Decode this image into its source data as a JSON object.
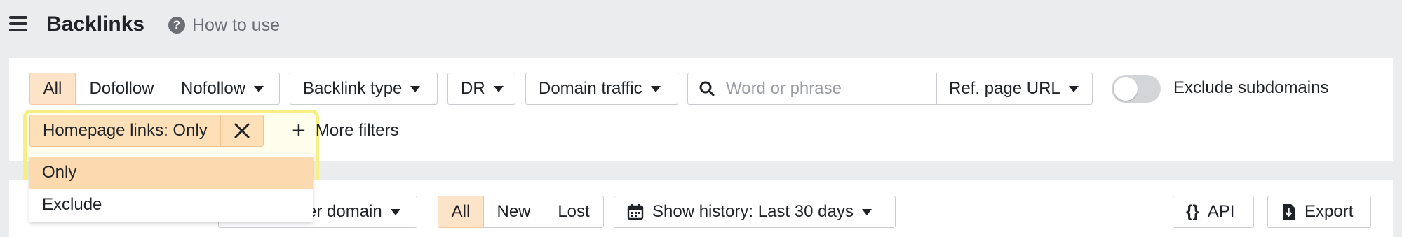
{
  "header": {
    "title": "Backlinks",
    "help_label": "How to use",
    "help_icon": "question-circle-icon",
    "menu_icon": "hamburger-menu-icon"
  },
  "filters": {
    "link_type_segments": [
      "All",
      "Dofollow",
      "Nofollow"
    ],
    "active_link_type": "All",
    "backlink_type": "Backlink type",
    "dr": "DR",
    "domain_traffic": "Domain traffic",
    "search": {
      "placeholder": "Word or phrase",
      "value": ""
    },
    "search_scope": "Ref. page URL",
    "exclude_subdomains": {
      "label": "Exclude subdomains",
      "enabled": false
    },
    "homepage_chip": "Homepage links: Only",
    "more_filters": "More filters",
    "homepage_options": [
      "Only",
      "Exclude"
    ],
    "homepage_selected": "Only"
  },
  "toolbar": {
    "grouping_partial": "er domain",
    "history_segments": [
      "All",
      "New",
      "Lost"
    ],
    "active_history": "All",
    "show_history": "Show history: Last 30 days",
    "api_label": "API",
    "export_label": "Export"
  },
  "colors": {
    "accent_fill": "#fde3c7",
    "highlight": "#f7ee86",
    "page_bg": "#ebecee"
  }
}
